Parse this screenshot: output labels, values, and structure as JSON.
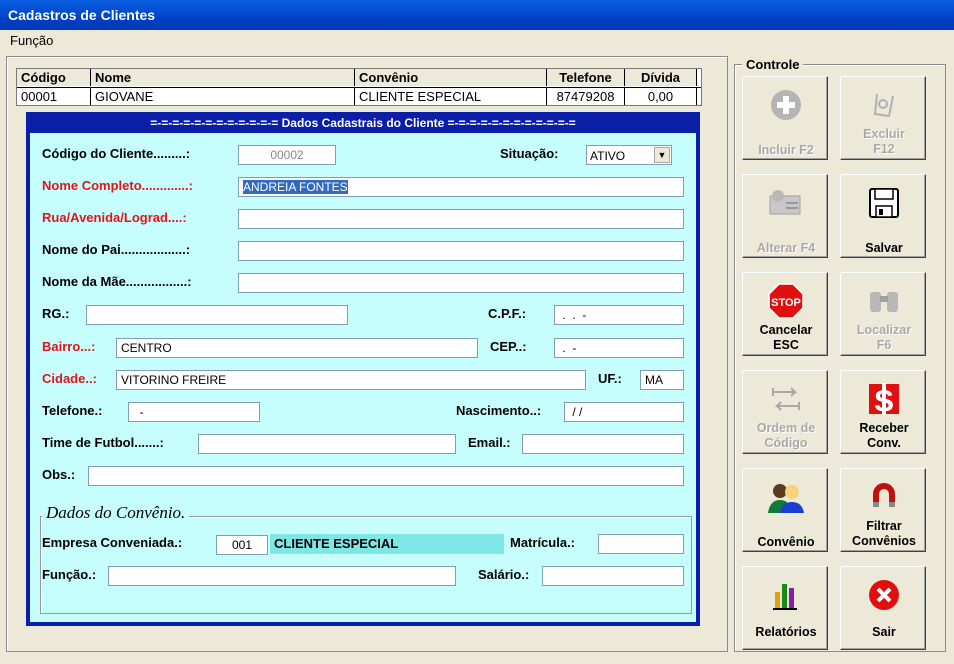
{
  "window": {
    "title": "Cadastros de Clientes"
  },
  "menu": {
    "items": [
      "Função"
    ]
  },
  "grid": {
    "columns": [
      "Código",
      "Nome",
      "Convênio",
      "Telefone",
      "Dívida"
    ],
    "rows": [
      [
        "00001",
        "GIOVANE",
        "CLIENTE ESPECIAL",
        "87479208",
        "0,00"
      ]
    ]
  },
  "form": {
    "title": "=-=-=-=-=-=-=-=-=-=-=-= Dados Cadastrais do Cliente =-=-=-=-=-=-=-=-=-=-=-=",
    "codigo": {
      "label": "Código do Cliente.........:",
      "value": "00002"
    },
    "situacao": {
      "label": "Situação:",
      "value": "ATIVO"
    },
    "nome": {
      "label": "Nome Completo.............:",
      "value": "ANDREIA FONTES"
    },
    "rua": {
      "label": "Rua/Avenida/Lograd....:",
      "value": ""
    },
    "pai": {
      "label": "Nome do Pai..................:",
      "value": ""
    },
    "mae": {
      "label": "Nome da Mãe.................:",
      "value": ""
    },
    "rg": {
      "label": "RG.:",
      "value": ""
    },
    "cpf": {
      "label": "C.P.F.:",
      "value": " .  .  -"
    },
    "bairro": {
      "label": "Bairro...:",
      "value": "CENTRO"
    },
    "cep": {
      "label": "CEP..:",
      "value": " .  -"
    },
    "cidade": {
      "label": "Cidade..:",
      "value": "VITORINO FREIRE"
    },
    "uf": {
      "label": "UF.:",
      "value": "MA"
    },
    "telefone": {
      "label": "Telefone.:",
      "value": "  -"
    },
    "nascimento": {
      "label": "Nascimento..:",
      "value": " / /"
    },
    "time": {
      "label": "Time de Futbol.......:",
      "value": ""
    },
    "email": {
      "label": "Email.:",
      "value": ""
    },
    "obs": {
      "label": "Obs.:",
      "value": ""
    }
  },
  "convenio": {
    "title": "Dados do Convênio.",
    "empresa": {
      "label": "Empresa Conveniada.:",
      "code": "001",
      "name": "CLIENTE ESPECIAL"
    },
    "matricula": {
      "label": "Matrícula.:",
      "value": ""
    },
    "funcao": {
      "label": "Função.:",
      "value": ""
    },
    "salario": {
      "label": "Salário.:",
      "value": ""
    }
  },
  "controle": {
    "title": "Controle",
    "buttons": {
      "incluir": "Incluir F2",
      "excluir": "Excluir\nF12",
      "alterar": "Alterar F4",
      "salvar": "Salvar",
      "cancelar": "Cancelar\nESC",
      "localizar": "Localizar\nF6",
      "ordem": "Ordem de\nCódigo",
      "receber": "Receber\nConv.",
      "convenio": "Convênio",
      "filtrar": "Filtrar\nConvênios",
      "relatorios": "Relatórios",
      "sair": "Sair"
    }
  },
  "colors": {
    "title_bar": "#0042c8",
    "form_frame": "#0a1ea8",
    "form_bg": "#c6fefe",
    "required_label": "#e0151a",
    "selection": "#316ac5"
  }
}
